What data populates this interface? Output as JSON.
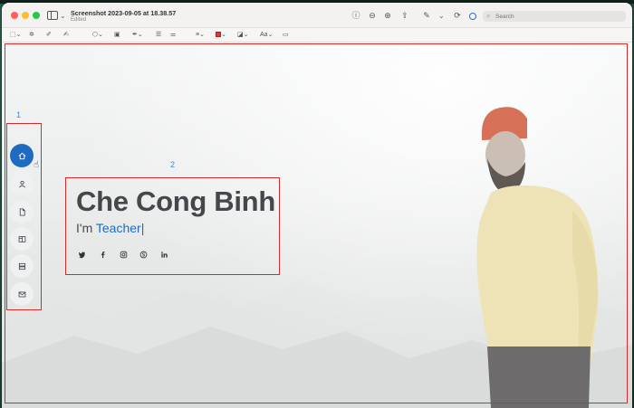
{
  "window": {
    "title": "Screenshot 2023-09-05 at 18.38.57",
    "subtitle": "Edited",
    "search_placeholder": "Search"
  },
  "markup_toolbar": {
    "text_style_label": "Aa"
  },
  "annotations": {
    "marker_1": "1",
    "marker_2": "2",
    "rect_color": "#d62b2b"
  },
  "nav": {
    "items": [
      {
        "icon": "home-icon",
        "active": true
      },
      {
        "icon": "user-icon",
        "active": false
      },
      {
        "icon": "document-icon",
        "active": false
      },
      {
        "icon": "book-icon",
        "active": false
      },
      {
        "icon": "server-icon",
        "active": false
      },
      {
        "icon": "envelope-icon",
        "active": false
      }
    ]
  },
  "hero": {
    "name": "Che Cong Binh",
    "role_prefix": "I'm",
    "role": "Teacher",
    "cursor": "|",
    "socials": [
      "twitter-icon",
      "facebook-icon",
      "instagram-icon",
      "skype-icon",
      "linkedin-icon"
    ]
  },
  "colors": {
    "accent": "#1f6bbf",
    "name_text": "#44474b",
    "annotation_red": "#d62b2b",
    "annotation_number_blue": "#3b8bd8"
  }
}
